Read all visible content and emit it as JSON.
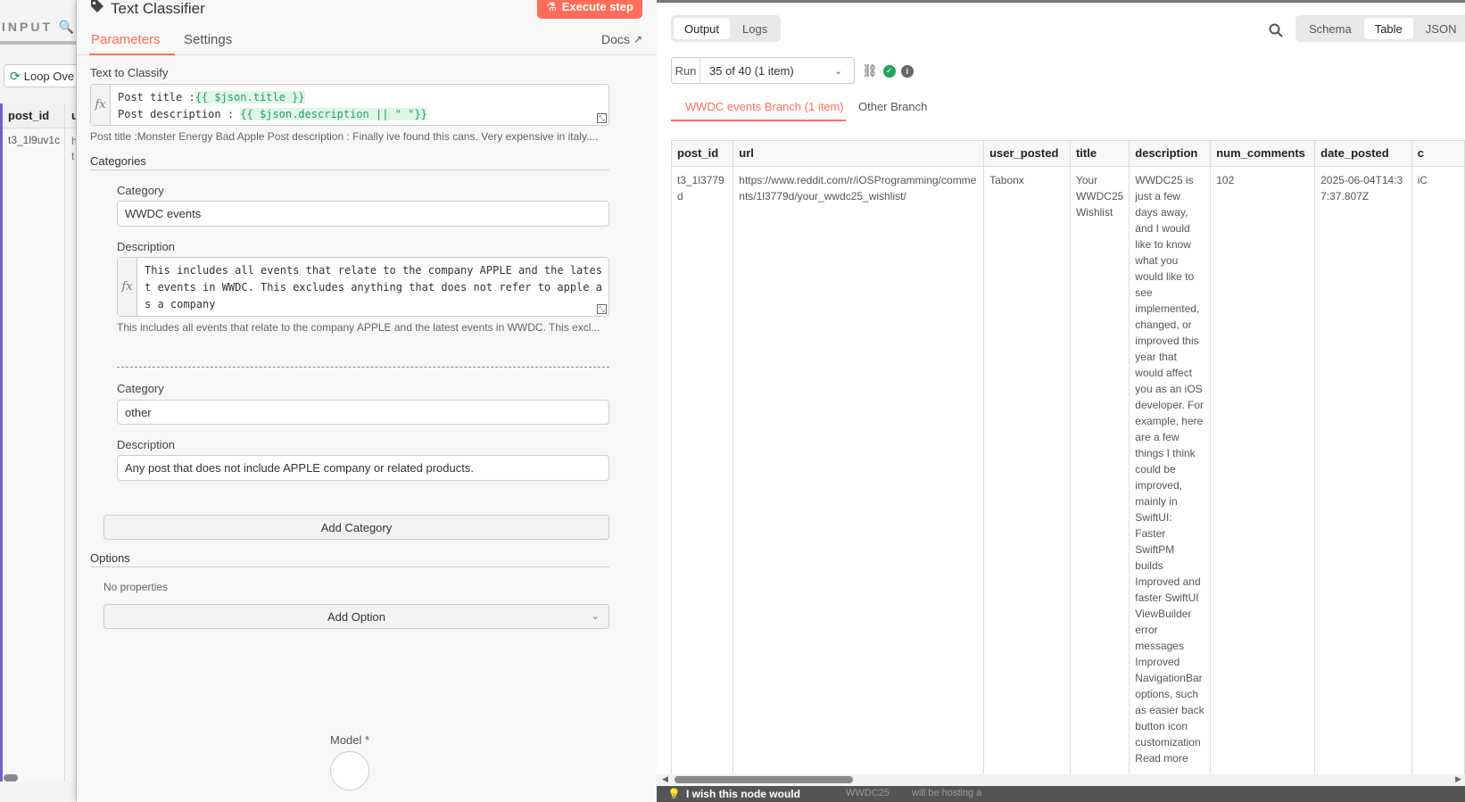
{
  "input_panel": {
    "title": "INPUT",
    "loop_button": "Loop Ove",
    "columns": [
      "post_id",
      "u"
    ],
    "row_post_id": "t3_1l9uv1c",
    "row_second": "h\nt"
  },
  "node": {
    "title": "Text Classifier",
    "execute_label": "Execute step",
    "tabs": [
      "Parameters",
      "Settings"
    ],
    "docs_label": "Docs",
    "text_to_classify": {
      "label": "Text to Classify",
      "line1_prefix": "Post title :",
      "line1_expr": "{{ $json.title }}",
      "line2_prefix": "Post description : ",
      "line2_expr": "{{ $json.description || \" \"}}",
      "preview": "Post title :Monster Energy Bad Apple Post description : Finally ive found this cans. Very expensive in italy...."
    },
    "categories_label": "Categories",
    "category_label": "Category",
    "description_label": "Description",
    "category1": {
      "name": "WWDC events",
      "description": "This includes all events that relate to the company APPLE and the latest events in WWDC. This excludes anything that does not refer to apple as a company",
      "preview": "This includes all events that relate to the company APPLE and the latest events in WWDC. This excl..."
    },
    "category2": {
      "name": "other",
      "description": "Any post that does not include APPLE company or related products."
    },
    "add_category": "Add Category",
    "options_label": "Options",
    "no_properties": "No properties",
    "add_option": "Add Option",
    "model_label": "Model *"
  },
  "output": {
    "view_tabs": [
      "Output",
      "Logs"
    ],
    "format_tabs": [
      "Schema",
      "Table",
      "JSON"
    ],
    "run_label": "Run",
    "run_value": "35 of 40 (1 item)",
    "branches": [
      "WWDC events Branch (1 item)",
      "Other Branch"
    ],
    "columns": [
      "post_id",
      "url",
      "user_posted",
      "title",
      "description",
      "num_comments",
      "date_posted",
      "c"
    ],
    "row": {
      "post_id": "t3_1l3779d",
      "url": "https://www.reddit.com/r/iOSProgramming/comments/1l3779d/your_wwdc25_wishlist/",
      "user_posted": "Tabonx",
      "title": "Your WWDC25 Wishlist",
      "description": "WWDC25 is just a few days away, and I would like to know what you would like to see implemented, changed, or improved this year that would affect you as an iOS developer. For example, here are a few things I think could be improved, mainly in SwiftUI: Faster SwiftPM builds Improved and faster SwiftUI ViewBuilder error messages Improved NavigationBar options, such as easier back button icon customization Read more",
      "num_comments": "102",
      "date_posted": "2025-06-04T14:37:37.807Z",
      "c": "iC"
    },
    "bottom_text": "I wish this node would",
    "bottom_ghost_1": "WWDC25",
    "bottom_ghost_2": "will be hosting a"
  },
  "colors": {
    "accent": "#ff6d5a",
    "success": "#21a35a",
    "expr_bg": "#dff5e8"
  }
}
